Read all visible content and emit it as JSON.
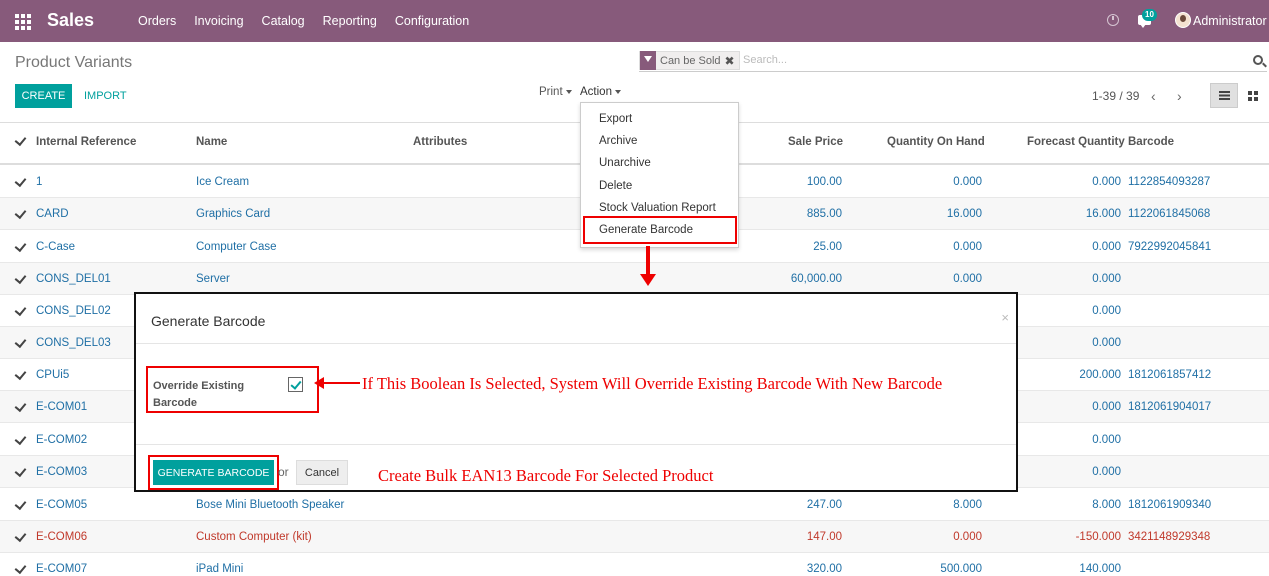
{
  "navbar": {
    "brand": "Sales",
    "menu": [
      "Orders",
      "Invoicing",
      "Catalog",
      "Reporting",
      "Configuration"
    ],
    "chat_count": "10",
    "user": "Administrator",
    "color": "#875a7b"
  },
  "control": {
    "title": "Product Variants",
    "facet": "Can be Sold",
    "search_placeholder": "Search...",
    "create": "CREATE",
    "import": "IMPORT",
    "print": "Print",
    "action": "Action",
    "pager": "1-39 / 39",
    "accent": "#00a09d"
  },
  "columns": {
    "ref": "Internal Reference",
    "name": "Name",
    "attributes": "Attributes",
    "sale_price": "Sale Price",
    "qty_on_hand": "Quantity On Hand",
    "forecast": "Forecast Quantity",
    "barcode": "Barcode"
  },
  "rows": [
    {
      "ref": "1",
      "name": "Ice Cream",
      "price": "100.00",
      "qty": "0.000",
      "forecast": "0.000",
      "barcode": "1122854093287"
    },
    {
      "ref": "CARD",
      "name": "Graphics Card",
      "price": "885.00",
      "qty": "16.000",
      "forecast": "16.000",
      "barcode": "1122061845068"
    },
    {
      "ref": "C-Case",
      "name": "Computer Case",
      "price": "25.00",
      "qty": "0.000",
      "forecast": "0.000",
      "barcode": "7922992045841"
    },
    {
      "ref": "CONS_DEL01",
      "name": "Server",
      "price": "60,000.00",
      "qty": "0.000",
      "forecast": "0.000",
      "barcode": ""
    },
    {
      "ref": "CONS_DEL02",
      "name": "",
      "price": "",
      "qty": "",
      "forecast": "0.000",
      "barcode": ""
    },
    {
      "ref": "CONS_DEL03",
      "name": "",
      "price": "",
      "qty": "",
      "forecast": "0.000",
      "barcode": ""
    },
    {
      "ref": "CPUi5",
      "name": "",
      "price": "",
      "qty": "",
      "forecast": "200.000",
      "barcode": "1812061857412"
    },
    {
      "ref": "E-COM01",
      "name": "",
      "price": "",
      "qty": "",
      "forecast": "0.000",
      "barcode": "1812061904017"
    },
    {
      "ref": "E-COM02",
      "name": "",
      "price": "",
      "qty": "",
      "forecast": "0.000",
      "barcode": ""
    },
    {
      "ref": "E-COM03",
      "name": "",
      "price": "",
      "qty": "",
      "forecast": "0.000",
      "barcode": ""
    },
    {
      "ref": "E-COM05",
      "name": "Bose Mini Bluetooth Speaker",
      "price": "247.00",
      "qty": "8.000",
      "forecast": "8.000",
      "barcode": "1812061909340"
    },
    {
      "ref": "E-COM06",
      "name": "Custom Computer (kit)",
      "price": "147.00",
      "qty": "0.000",
      "forecast": "-150.000",
      "barcode": "3421148929348"
    },
    {
      "ref": "E-COM07",
      "name": "iPad Mini",
      "price": "320.00",
      "qty": "500.000",
      "forecast": "140.000",
      "barcode": ""
    }
  ],
  "action_menu": [
    "Export",
    "Archive",
    "Unarchive",
    "Delete",
    "Stock Valuation Report",
    "Generate Barcode"
  ],
  "modal": {
    "title": "Generate Barcode",
    "override_label": "Override Existing Barcode",
    "override_checked": true,
    "generate": "GENERATE BARCODE",
    "or": "or",
    "cancel": "Cancel",
    "annotation_override": "If This Boolean Is Selected, System Will Override Existing Barcode With New Barcode",
    "annotation_generate": "Create Bulk EAN13 Barcode For Selected Product"
  }
}
